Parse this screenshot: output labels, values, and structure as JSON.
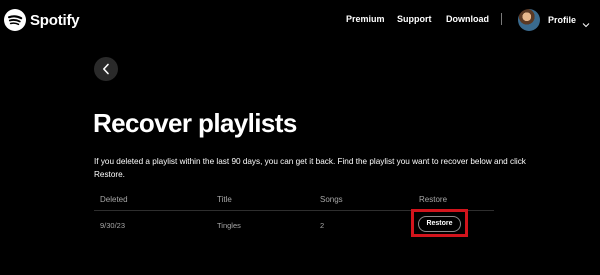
{
  "header": {
    "logo_text": "Spotify",
    "nav": {
      "premium": "Premium",
      "support": "Support",
      "download": "Download"
    },
    "profile_label": "Profile"
  },
  "page": {
    "title": "Recover playlists",
    "description": "If you deleted a playlist within the last 90 days, you can get it back. Find the playlist you want to recover below and click Restore."
  },
  "table": {
    "headers": {
      "deleted": "Deleted",
      "title": "Title",
      "songs": "Songs",
      "restore": "Restore"
    },
    "rows": [
      {
        "deleted": "9/30/23",
        "title": "Tingles",
        "songs": "2",
        "action_label": "Restore"
      }
    ]
  },
  "colors": {
    "background": "#000000",
    "highlight": "#d2141c",
    "muted_text": "#a7a7a7"
  },
  "icons": [
    "spotify-logo-icon",
    "chevron-down-icon",
    "chevron-left-icon"
  ]
}
